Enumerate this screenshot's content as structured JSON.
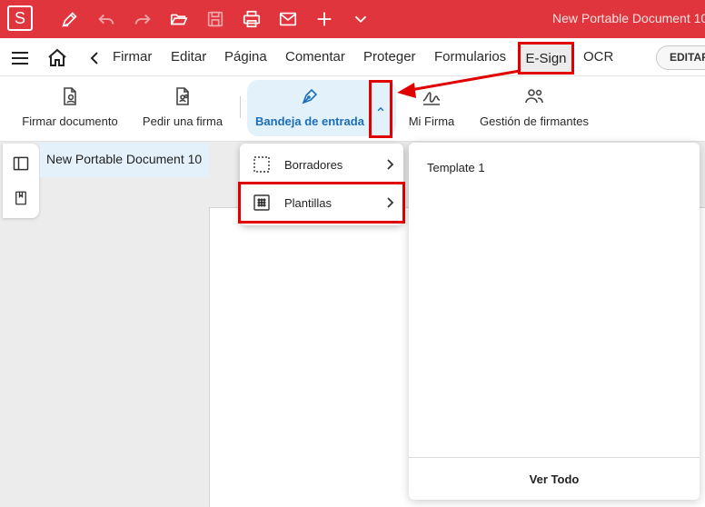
{
  "window": {
    "title": "New Portable Document 10"
  },
  "titlebar": {
    "logo_letter": "S",
    "icons": [
      "pen-icon",
      "undo-icon",
      "redo-icon",
      "folder-open-icon",
      "save-icon",
      "print-icon",
      "mail-icon",
      "plus-icon",
      "chevron-down-icon"
    ]
  },
  "menubar": {
    "items": [
      "Firmar",
      "Editar",
      "Página",
      "Comentar",
      "Proteger",
      "Formularios",
      "E-Sign",
      "OCR"
    ],
    "edit_pill": "EDITAR"
  },
  "toolbar": {
    "sign_document": "Firmar documento",
    "request_signature": "Pedir una firma",
    "inbox": "Bandeja de entrada",
    "my_signature": "Mi Firma",
    "signer_management": "Gestión de firmantes"
  },
  "document_tab": {
    "title": "New Portable Document 10"
  },
  "dropdown": {
    "items": [
      {
        "label": "Borradores"
      },
      {
        "label": "Plantillas"
      }
    ]
  },
  "templates_panel": {
    "items": [
      "Template 1"
    ],
    "footer": "Ver Todo"
  },
  "colors": {
    "brand_red": "#e0353c",
    "highlight_red": "#e00000",
    "inbox_blue": "#1a6fb8",
    "inbox_bg": "#e3f1fb"
  }
}
